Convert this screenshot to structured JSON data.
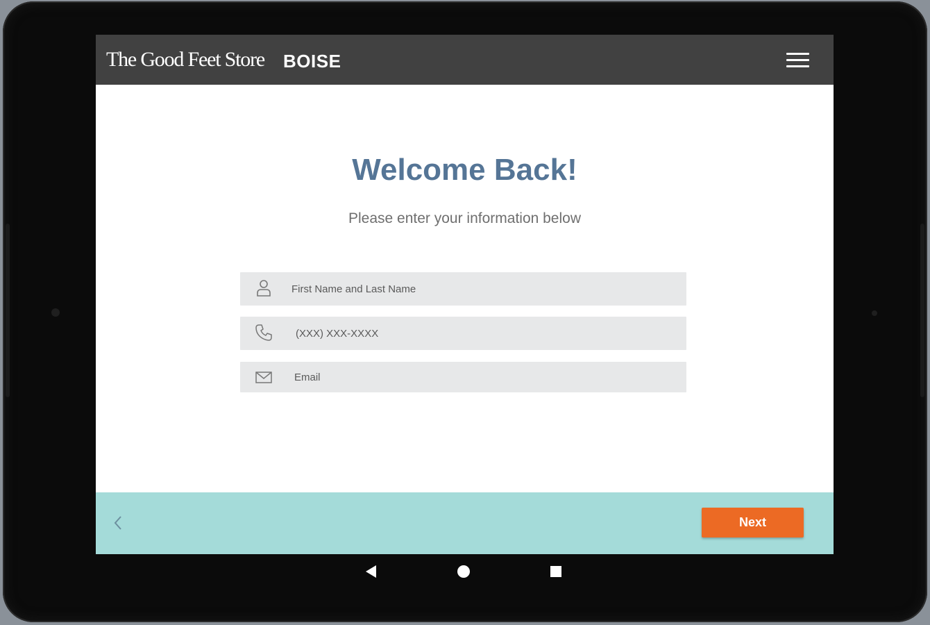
{
  "header": {
    "brand": "The Good Feet Store",
    "location": "BOISE",
    "menu_icon": "hamburger-menu-icon"
  },
  "main": {
    "title": "Welcome Back!",
    "subtitle": "Please enter your information below"
  },
  "form": {
    "name": {
      "placeholder": "First Name and Last Name",
      "value": "",
      "icon": "person-icon"
    },
    "phone": {
      "placeholder": "(XXX) XXX-XXXX",
      "value": "",
      "icon": "phone-icon"
    },
    "email": {
      "placeholder": "Email",
      "value": "",
      "icon": "envelope-icon"
    }
  },
  "footer": {
    "back_icon": "chevron-left-icon",
    "next_label": "Next"
  },
  "android_nav": {
    "back_icon": "triangle-back-icon",
    "home_icon": "circle-home-icon",
    "recent_icon": "square-recents-icon"
  },
  "colors": {
    "header_bg": "#414141",
    "title": "#557596",
    "field_bg": "#e7e8e9",
    "footer_bg": "#a4dbd9",
    "next_button": "#ec6a24"
  }
}
